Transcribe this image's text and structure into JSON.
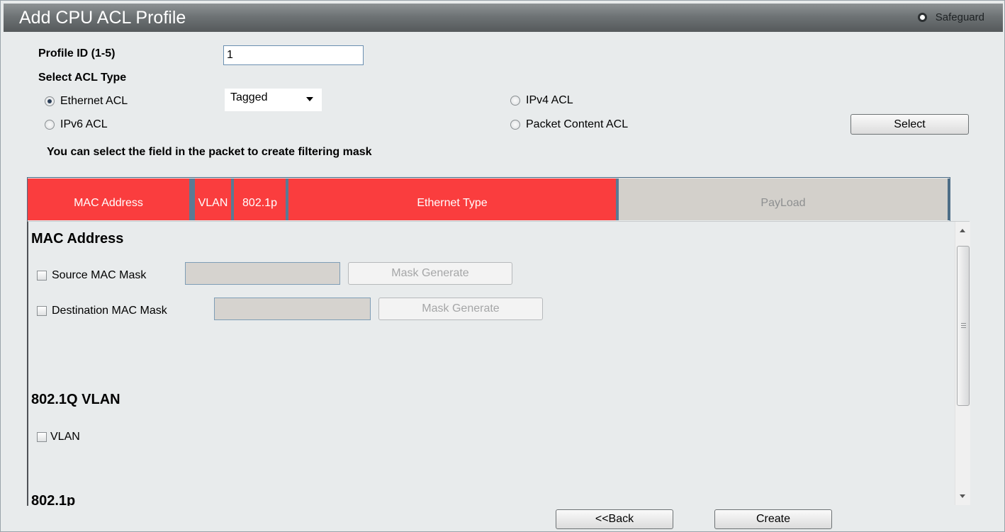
{
  "window": {
    "title": "Add CPU ACL Profile",
    "safeguard_label": "Safeguard"
  },
  "form": {
    "profile_id_label": "Profile ID (1-5)",
    "profile_id_value": "1",
    "select_acl_type_label": "Select ACL Type",
    "acl_types": [
      {
        "label": "Ethernet ACL",
        "selected": true
      },
      {
        "label": "IPv4 ACL",
        "selected": false
      },
      {
        "label": "IPv6 ACL",
        "selected": false
      },
      {
        "label": "Packet Content ACL",
        "selected": false
      }
    ],
    "tag_select_value": "Tagged",
    "select_button_label": "Select",
    "hint": "You can select the field in the packet to create filtering mask"
  },
  "packet_tabs": [
    {
      "label": "MAC Address",
      "active": true
    },
    {
      "label": "VLAN",
      "active": true
    },
    {
      "label": "802.1p",
      "active": true
    },
    {
      "label": "Ethernet Type",
      "active": true
    },
    {
      "label": "PayLoad",
      "active": false
    }
  ],
  "sections": {
    "mac_address": {
      "title": "MAC Address",
      "source_mask_label": "Source MAC Mask",
      "destination_mask_label": "Destination MAC Mask",
      "mask_generate_label": "Mask Generate"
    },
    "vlan": {
      "title": "802.1Q VLAN",
      "vlan_label": "VLAN"
    },
    "dot1p": {
      "title": "802.1p"
    }
  },
  "footer": {
    "back_label": "<<Back",
    "create_label": "Create"
  },
  "colors": {
    "active_tab": "#fa3d3e",
    "inactive_tab": "#d3d0cb",
    "titlebar": "#6e7375"
  }
}
